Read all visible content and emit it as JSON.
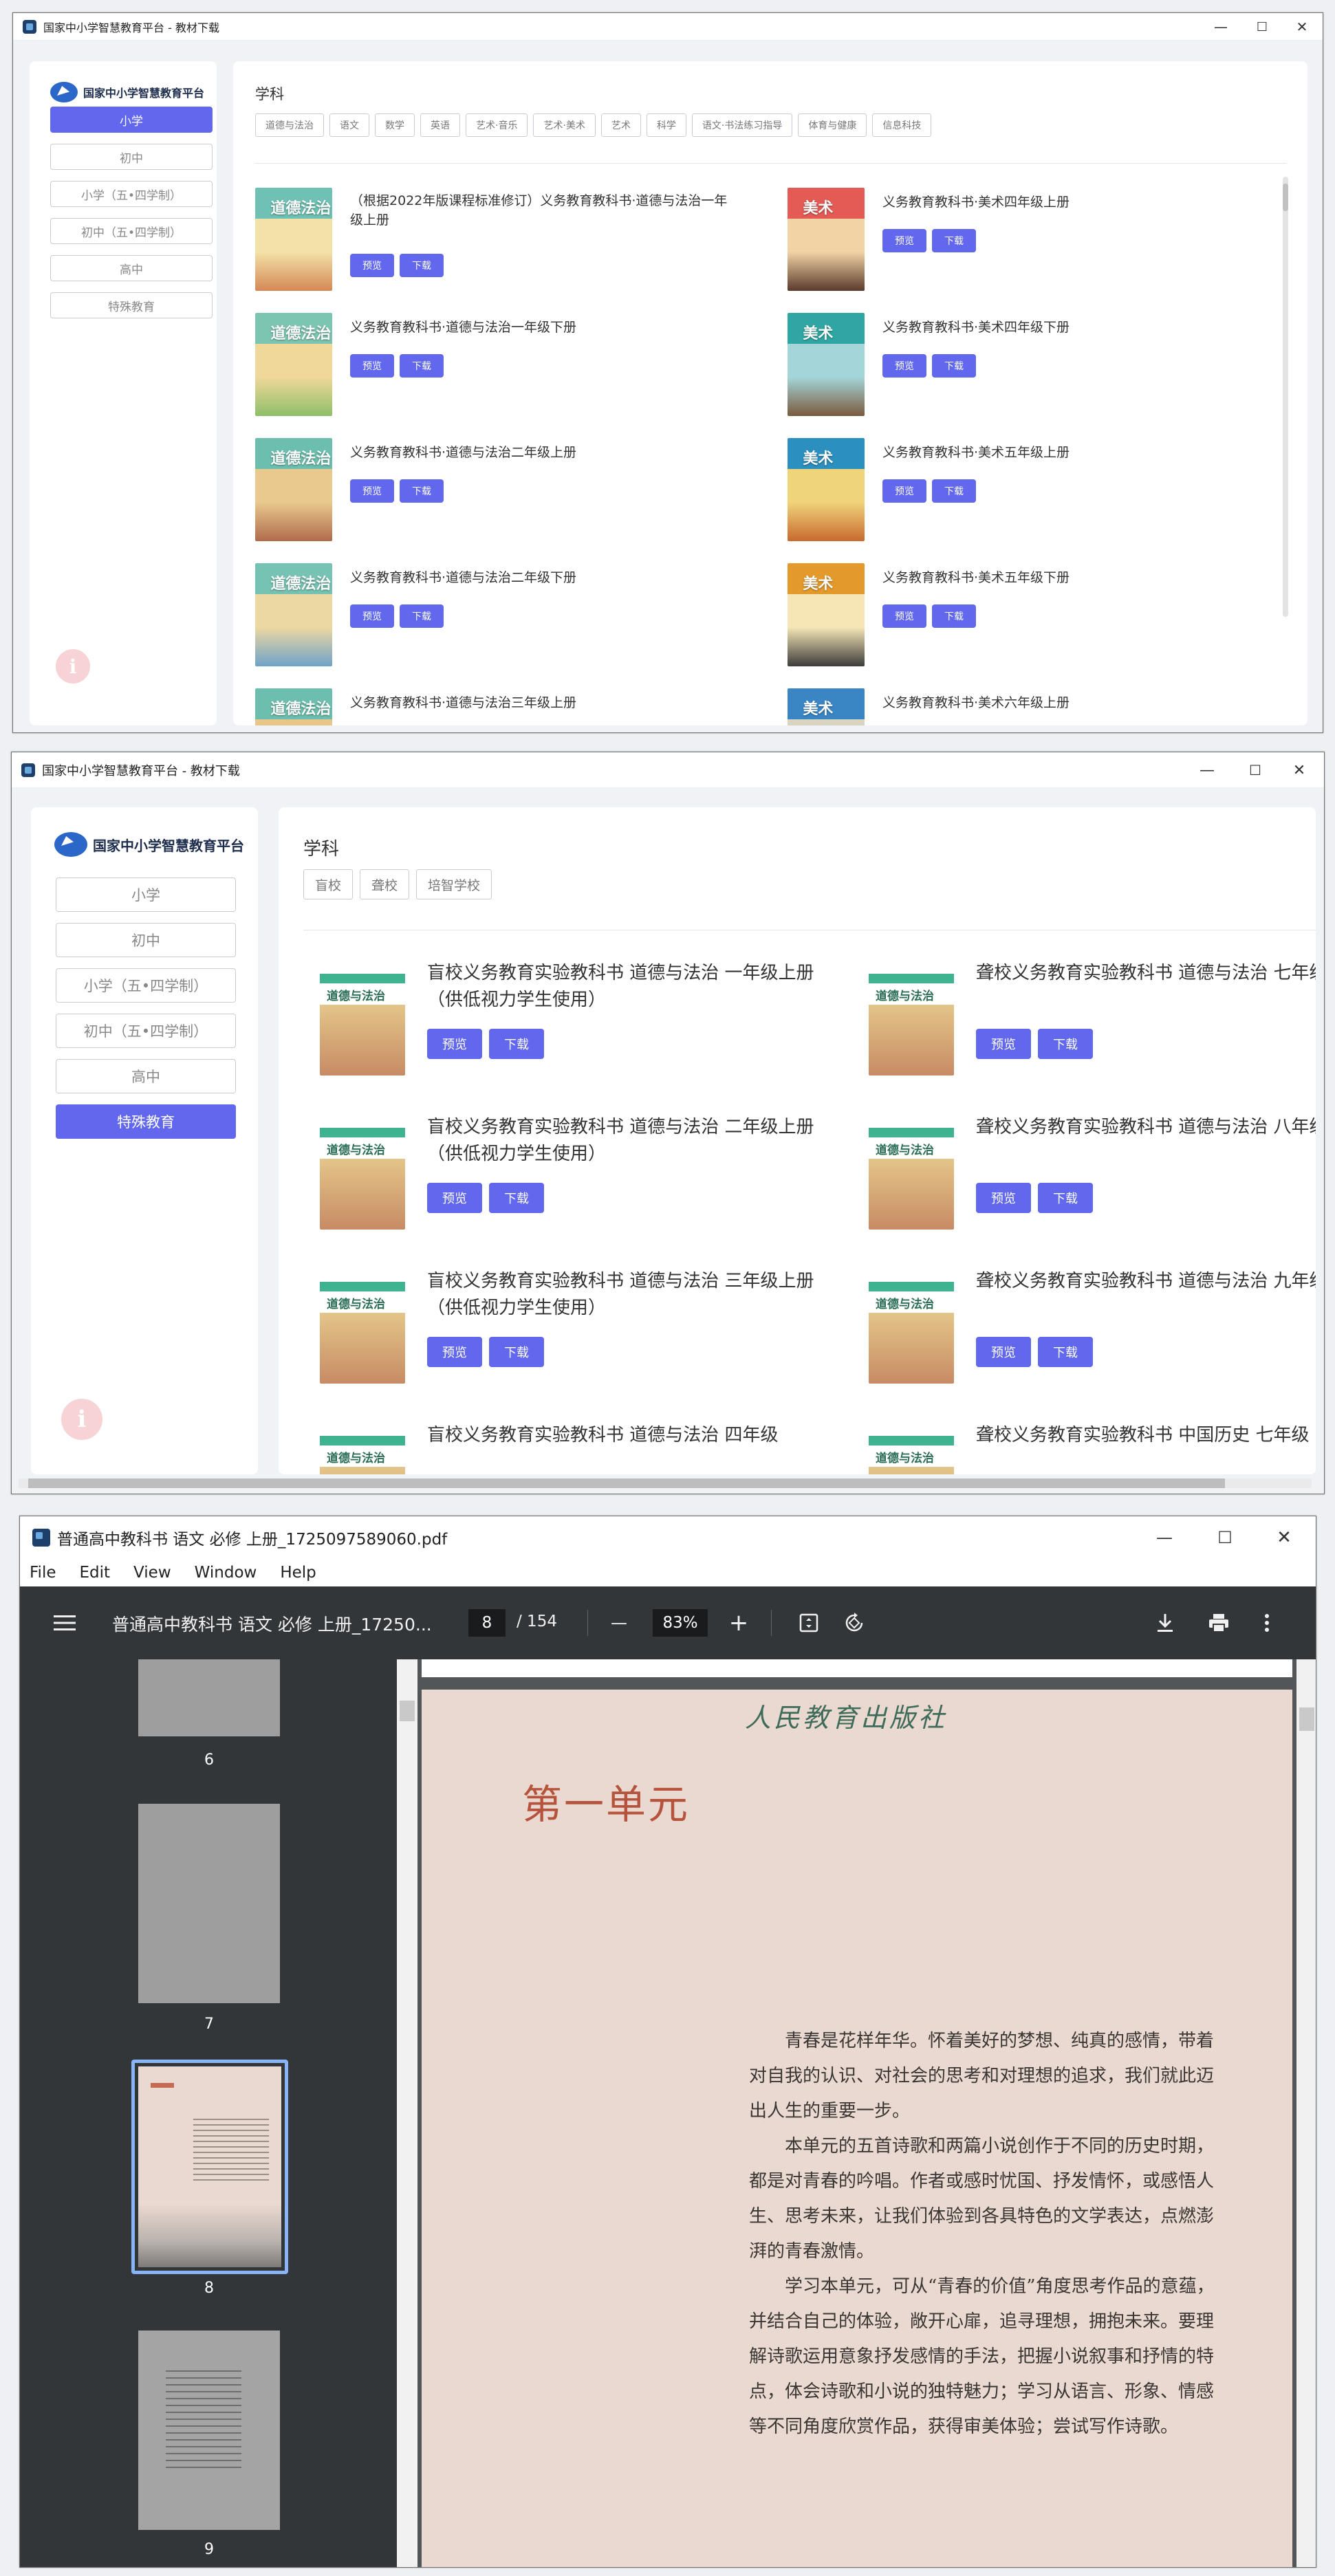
{
  "colors": {
    "accent": "#6168ee",
    "pdf_toolbar": "#323639",
    "pdf_bg": "#525659",
    "page_bg": "#ead9d0",
    "title_red": "#b5533c"
  },
  "win1": {
    "title": "国家中小学智慧教育平台 - 教材下载",
    "controls": [
      "—",
      "☐",
      "✕"
    ],
    "logo_text": "国家中小学智慧教育平台",
    "nav": [
      "小学",
      "初中",
      "小学（五•四学制）",
      "初中（五•四学制）",
      "高中",
      "特殊教育"
    ],
    "active_nav": 0,
    "subject_label": "学科",
    "subjects": [
      "道德与法治",
      "语文",
      "数学",
      "英语",
      "艺术·音乐",
      "艺术·美术",
      "艺术",
      "科学",
      "语文·书法练习指导",
      "体育与健康",
      "信息科技"
    ],
    "preview": "预览",
    "download": "下载",
    "books": [
      {
        "title": "（根据2022年版课程标准修订）义务教育教科书·道德与法治一年级上册",
        "cover": "moral1"
      },
      {
        "title": "义务教育教科书·美术四年级上册",
        "cover": "art4a"
      },
      {
        "title": "义务教育教科书·道德与法治一年级下册",
        "cover": "moral1b"
      },
      {
        "title": "义务教育教科书·美术四年级下册",
        "cover": "art4b"
      },
      {
        "title": "义务教育教科书·道德与法治二年级上册",
        "cover": "moral2a"
      },
      {
        "title": "义务教育教科书·美术五年级上册",
        "cover": "art5a"
      },
      {
        "title": "义务教育教科书·道德与法治二年级下册",
        "cover": "moral2b"
      },
      {
        "title": "义务教育教科书·美术五年级下册",
        "cover": "art5b"
      },
      {
        "title": "义务教育教科书·道德与法治三年级上册",
        "cover": "moral3a"
      },
      {
        "title": "义务教育教科书·美术六年级上册",
        "cover": "art6a"
      }
    ],
    "info_icon": "i"
  },
  "win2": {
    "title": "国家中小学智慧教育平台 - 教材下载",
    "controls": [
      "—",
      "☐",
      "✕"
    ],
    "logo_text": "国家中小学智慧教育平台",
    "nav": [
      "小学",
      "初中",
      "小学（五•四学制）",
      "初中（五•四学制）",
      "高中",
      "特殊教育"
    ],
    "active_nav": 5,
    "subject_label": "学科",
    "subjects": [
      "盲校",
      "聋校",
      "培智学校"
    ],
    "preview": "预览",
    "download": "下载",
    "books": [
      {
        "title": "盲校义务教育实验教科书 道德与法治 一年级上册（供低视力学生使用）"
      },
      {
        "title": "聋校义务教育实验教科书 道德与法治 七年级上册"
      },
      {
        "title": "盲校义务教育实验教科书 道德与法治 二年级上册（供低视力学生使用）"
      },
      {
        "title": "聋校义务教育实验教科书 道德与法治 八年级上册"
      },
      {
        "title": "盲校义务教育实验教科书 道德与法治 三年级上册（供低视力学生使用）"
      },
      {
        "title": "聋校义务教育实验教科书 道德与法治 九年级上册"
      },
      {
        "title": "盲校义务教育实验教科书 道德与法治 四年级"
      },
      {
        "title": "聋校义务教育实验教科书 中国历史 七年级"
      }
    ],
    "cover_label": "道德与法治",
    "info_icon": "i"
  },
  "win3": {
    "title": "普通高中教科书 语文 必修 上册_1725097589060.pdf",
    "controls": [
      "—",
      "☐",
      "✕"
    ],
    "menu": [
      "File",
      "Edit",
      "View",
      "Window",
      "Help"
    ],
    "toolbar": {
      "doc_title": "普通高中教科书 语文 必修 上册_17250...",
      "page": "8",
      "total": "/ 154",
      "zoom": "83%",
      "minus": "—",
      "plus": "+"
    },
    "thumbs": [
      "6",
      "7",
      "8",
      "9"
    ],
    "selected_thumb": "8",
    "publisher": "人民教育出版社",
    "unit_title": "第一单元",
    "paragraphs": [
      "青春是花样年华。怀着美好的梦想、纯真的感情，带着对自我的认识、对社会的思考和对理想的追求，我们就此迈出人生的重要一步。",
      "本单元的五首诗歌和两篇小说创作于不同的历史时期，都是对青春的吟唱。作者或感时忧国、抒发情怀，或感悟人生、思考未来，让我们体验到各具特色的文学表达，点燃澎湃的青春激情。",
      "学习本单元，可从“青春的价值”角度思考作品的意蕴，并结合自己的体验，敞开心扉，追寻理想，拥抱未来。要理解诗歌运用意象抒发感情的手法，把握小说叙事和抒情的特点，体会诗歌和小说的独特魅力；学习从语言、形象、情感等不同角度欣赏作品，获得审美体验；尝试写作诗歌。"
    ]
  }
}
